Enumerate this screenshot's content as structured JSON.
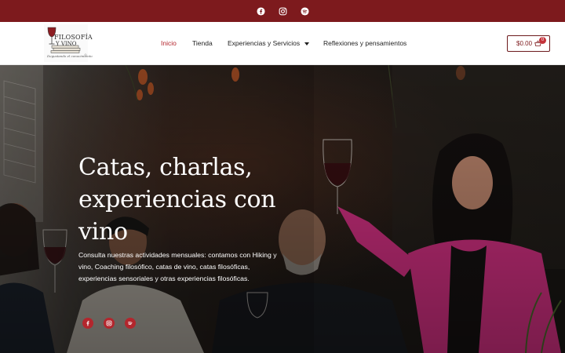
{
  "topbar": {
    "background": "#7d1a1d",
    "social_icons": [
      "facebook-icon",
      "instagram-icon",
      "spotify-icon"
    ]
  },
  "logo": {
    "word_line1": "FILOSOFÍA",
    "word_line2": "Y VINO",
    "tagline": "Degustando el conocimiento"
  },
  "nav": {
    "items": [
      {
        "label": "Inicio",
        "active": true
      },
      {
        "label": "Tienda",
        "active": false
      },
      {
        "label": "Experiencias y Servicios",
        "active": false,
        "has_dropdown": true
      },
      {
        "label": "Reflexiones y pensamientos",
        "active": false
      }
    ],
    "accent": "#b3262d"
  },
  "cart": {
    "total": "$0.00",
    "count": "0"
  },
  "hero": {
    "title": "Catas, charlas, experiencias con vino",
    "description": "Consulta nuestras actividades mensuales: contamos con Hiking y vino, Coaching filosófico, catas de vino, catas filosóficas, experiencias sensoriales y otras experiencias filosóficas.",
    "social_icons": [
      "facebook-icon",
      "instagram-icon",
      "spotify-icon"
    ]
  }
}
